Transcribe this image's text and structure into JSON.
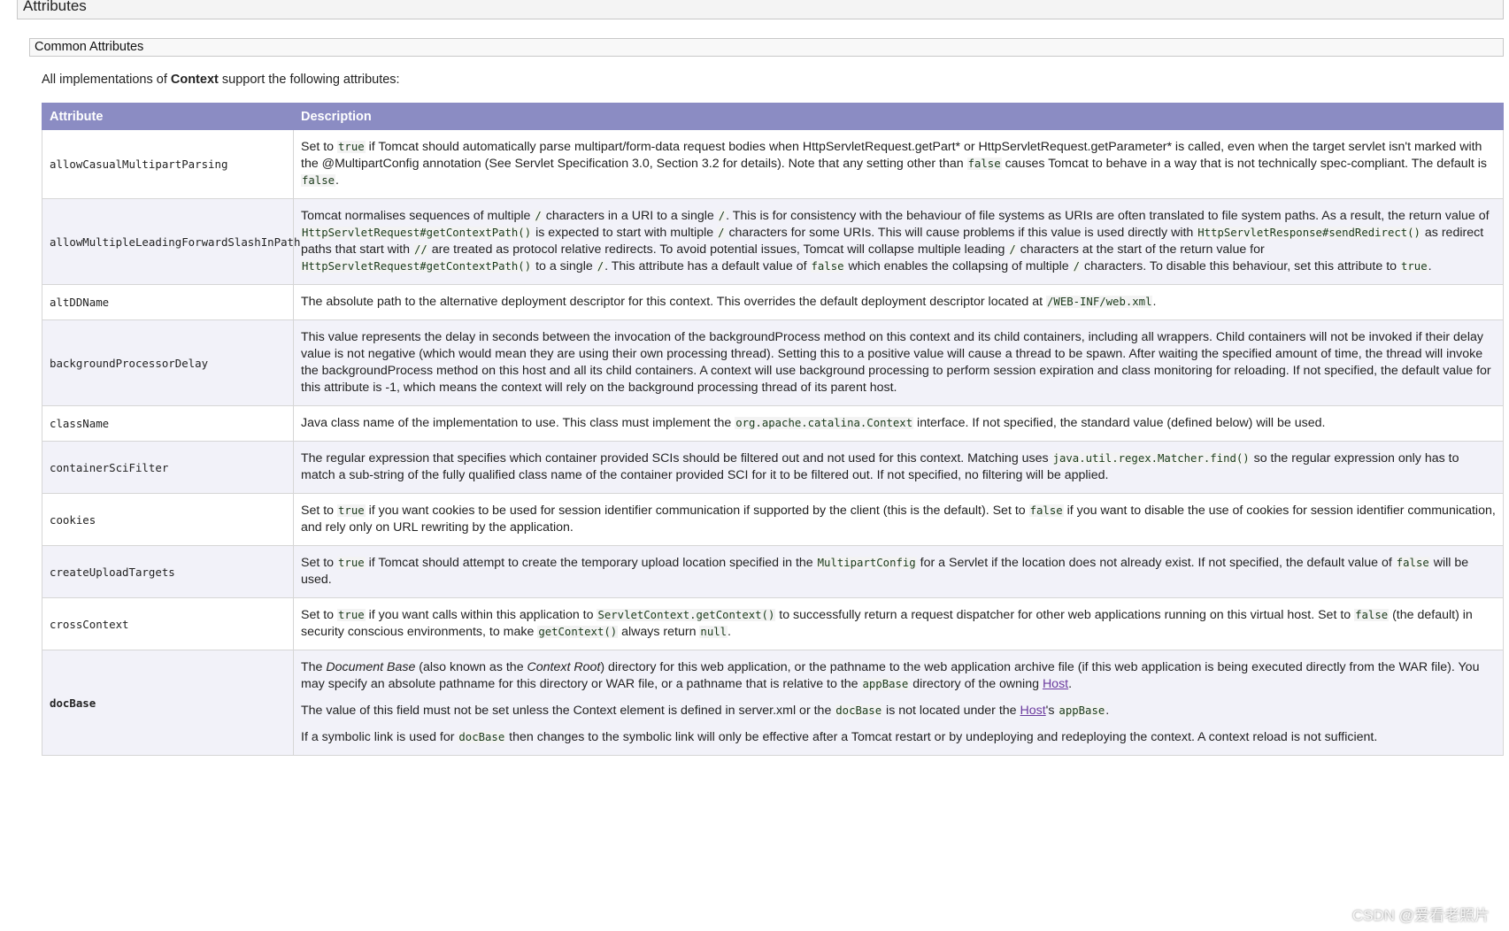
{
  "section": {
    "title": "Attributes"
  },
  "subsection": {
    "title": "Common Attributes"
  },
  "intro": {
    "before": "All implementations of ",
    "bold": "Context",
    "after": " support the following attributes:"
  },
  "table": {
    "headers": {
      "attribute": "Attribute",
      "description": "Description"
    },
    "rows": [
      {
        "name": "allowCasualMultipartParsing",
        "desc": [
          {
            "t": "Set to "
          },
          {
            "c": "true"
          },
          {
            "t": " if Tomcat should automatically parse multipart/form-data request bodies when HttpServletRequest.getPart* or HttpServletRequest.getParameter* is called, even when the target servlet isn't marked with the @MultipartConfig annotation (See Servlet Specification 3.0, Section 3.2 for details). Note that any setting other than "
          },
          {
            "c": "false"
          },
          {
            "t": " causes Tomcat to behave in a way that is not technically spec-compliant. The default is "
          },
          {
            "c": "false"
          },
          {
            "t": "."
          }
        ]
      },
      {
        "name": "allowMultipleLeadingForwardSlashInPath",
        "desc": [
          {
            "t": "Tomcat normalises sequences of multiple "
          },
          {
            "c": "/"
          },
          {
            "t": " characters in a URI to a single "
          },
          {
            "c": "/"
          },
          {
            "t": ". This is for consistency with the behaviour of file systems as URIs are often translated to file system paths. As a result, the return value of "
          },
          {
            "c": "HttpServletRequest#getContextPath()"
          },
          {
            "t": " is expected to start with multiple "
          },
          {
            "c": "/"
          },
          {
            "t": " characters for some URIs. This will cause problems if this value is used directly with "
          },
          {
            "c": "HttpServletResponse#sendRedirect()"
          },
          {
            "t": " as redirect paths that start with "
          },
          {
            "c": "//"
          },
          {
            "t": " are treated as protocol relative redirects. To avoid potential issues, Tomcat will collapse multiple leading "
          },
          {
            "c": "/"
          },
          {
            "t": " characters at the start of the return value for "
          },
          {
            "c": "HttpServletRequest#getContextPath()"
          },
          {
            "t": " to a single "
          },
          {
            "c": "/"
          },
          {
            "t": ". This attribute has a default value of "
          },
          {
            "c": "false"
          },
          {
            "t": " which enables the collapsing of multiple "
          },
          {
            "c": "/"
          },
          {
            "t": " characters. To disable this behaviour, set this attribute to "
          },
          {
            "c": "true"
          },
          {
            "t": "."
          }
        ]
      },
      {
        "name": "altDDName",
        "desc": [
          {
            "t": "The absolute path to the alternative deployment descriptor for this context. This overrides the default deployment descriptor located at "
          },
          {
            "c": "/WEB-INF/web.xml"
          },
          {
            "t": "."
          }
        ]
      },
      {
        "name": "backgroundProcessorDelay",
        "desc": [
          {
            "t": "This value represents the delay in seconds between the invocation of the backgroundProcess method on this context and its child containers, including all wrappers. Child containers will not be invoked if their delay value is not negative (which would mean they are using their own processing thread). Setting this to a positive value will cause a thread to be spawn. After waiting the specified amount of time, the thread will invoke the backgroundProcess method on this host and all its child containers. A context will use background processing to perform session expiration and class monitoring for reloading. If not specified, the default value for this attribute is -1, which means the context will rely on the background processing thread of its parent host."
          }
        ]
      },
      {
        "name": "className",
        "desc": [
          {
            "t": "Java class name of the implementation to use. This class must implement the "
          },
          {
            "c": "org.apache.catalina.Context"
          },
          {
            "t": " interface. If not specified, the standard value (defined below) will be used."
          }
        ]
      },
      {
        "name": "containerSciFilter",
        "desc": [
          {
            "t": "The regular expression that specifies which container provided SCIs should be filtered out and not used for this context. Matching uses "
          },
          {
            "c": "java.util.regex.Matcher.find()"
          },
          {
            "t": " so the regular expression only has to match a sub-string of the fully qualified class name of the container provided SCI for it to be filtered out. If not specified, no filtering will be applied."
          }
        ]
      },
      {
        "name": "cookies",
        "desc": [
          {
            "t": "Set to "
          },
          {
            "c": "true"
          },
          {
            "t": " if you want cookies to be used for session identifier communication if supported by the client (this is the default). Set to "
          },
          {
            "c": "false"
          },
          {
            "t": " if you want to disable the use of cookies for session identifier communication, and rely only on URL rewriting by the application."
          }
        ]
      },
      {
        "name": "createUploadTargets",
        "desc": [
          {
            "t": "Set to "
          },
          {
            "c": "true"
          },
          {
            "t": " if Tomcat should attempt to create the temporary upload location specified in the "
          },
          {
            "c": "MultipartConfig"
          },
          {
            "t": " for a Servlet if the location does not already exist. If not specified, the default value of "
          },
          {
            "c": "false"
          },
          {
            "t": " will be used."
          }
        ]
      },
      {
        "name": "crossContext",
        "desc": [
          {
            "t": "Set to "
          },
          {
            "c": "true"
          },
          {
            "t": " if you want calls within this application to "
          },
          {
            "c": "ServletContext.getContext()"
          },
          {
            "t": " to successfully return a request dispatcher for other web applications running on this virtual host. Set to "
          },
          {
            "c": "false"
          },
          {
            "t": " (the default) in security conscious environments, to make "
          },
          {
            "c": "getContext()"
          },
          {
            "t": " always return "
          },
          {
            "c": "null"
          },
          {
            "t": "."
          }
        ]
      },
      {
        "name": "docBase",
        "bold": true,
        "paras": [
          [
            {
              "t": "The "
            },
            {
              "i": "Document Base"
            },
            {
              "t": " (also known as the "
            },
            {
              "i": "Context Root"
            },
            {
              "t": ") directory for this web application, or the pathname to the web application archive file (if this web application is being executed directly from the WAR file). You may specify an absolute pathname for this directory or WAR file, or a pathname that is relative to the "
            },
            {
              "c": "appBase"
            },
            {
              "t": " directory of the owning "
            },
            {
              "a": "Host"
            },
            {
              "t": "."
            }
          ],
          [
            {
              "t": "The value of this field must not be set unless the Context element is defined in server.xml or the "
            },
            {
              "c": "docBase"
            },
            {
              "t": " is not located under the "
            },
            {
              "a": "Host"
            },
            {
              "t": "'s "
            },
            {
              "c": "appBase"
            },
            {
              "t": "."
            }
          ],
          [
            {
              "t": "If a symbolic link is used for "
            },
            {
              "c": "docBase"
            },
            {
              "t": " then changes to the symbolic link will only be effective after a Tomcat restart or by undeploying and redeploying the context. A context reload is not sufficient."
            }
          ]
        ]
      }
    ]
  },
  "watermark": "CSDN @爱看老照片"
}
